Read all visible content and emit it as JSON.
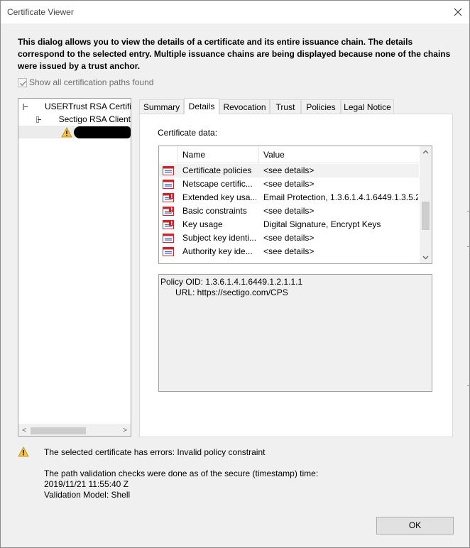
{
  "window": {
    "title": "Certificate Viewer",
    "close_glyph": "✕"
  },
  "intro_text": "This dialog allows you to view the details of a certificate and its entire issuance chain. The details correspond to the selected entry. Multiple issuance chains are being displayed because none of the chains were issued by a trust anchor.",
  "show_all_paths": {
    "label": "Show all certification paths found",
    "checked": true
  },
  "tree": {
    "items": [
      {
        "label": "USERTrust RSA Certifi",
        "level": 0,
        "expanded": true
      },
      {
        "label": "Sectigo RSA Client",
        "level": 1,
        "expanded": true
      },
      {
        "label": "",
        "level": 2,
        "selected": true,
        "icon": "warning-icon",
        "redacted": true
      }
    ]
  },
  "tabs": [
    {
      "label": "Summary",
      "active": false
    },
    {
      "label": "Details",
      "active": true
    },
    {
      "label": "Revocation",
      "active": false
    },
    {
      "label": "Trust",
      "active": false
    },
    {
      "label": "Policies",
      "active": false
    },
    {
      "label": "Legal Notice",
      "active": false
    }
  ],
  "details": {
    "certificate_data_label": "Certificate data:",
    "columns": [
      "Name",
      "Value"
    ],
    "rows": [
      {
        "name": "Certificate policies",
        "value": "<see details>",
        "icon": "certificate-field-icon",
        "selected": true
      },
      {
        "name": "Netscape certific...",
        "value": "<see details>",
        "icon": "certificate-field-icon"
      },
      {
        "name": "Extended key usa...",
        "value": "Email Protection, 1.3.6.1.4.1.6449.1.3.5.2",
        "icon": "certificate-critical-field-icon"
      },
      {
        "name": "Basic constraints",
        "value": "<see details>",
        "icon": "certificate-critical-field-icon"
      },
      {
        "name": "Key usage",
        "value": "Digital Signature, Encrypt Keys",
        "icon": "certificate-critical-field-icon"
      },
      {
        "name": "Subject key identi...",
        "value": "<see details>",
        "icon": "certificate-field-icon"
      },
      {
        "name": "Authority key ide...",
        "value": "<see details>",
        "icon": "certificate-field-icon"
      }
    ],
    "detail_lines": [
      "Policy OID: 1.3.6.1.4.1.6449.1.2.1.1.1",
      "URL: https://sectigo.com/CPS"
    ]
  },
  "status": {
    "error_text": "The selected certificate has errors: Invalid policy constraint",
    "validation_lines": [
      "The path validation checks were done as of the secure (timestamp) time:",
      "2019/11/21 11:55:40 Z",
      "Validation Model: Shell"
    ]
  },
  "buttons": {
    "ok": "OK"
  },
  "colors": {
    "warning": "#f6c342",
    "cert_icon_red": "#c8262c",
    "cert_icon_blue": "#3a6fb0"
  }
}
